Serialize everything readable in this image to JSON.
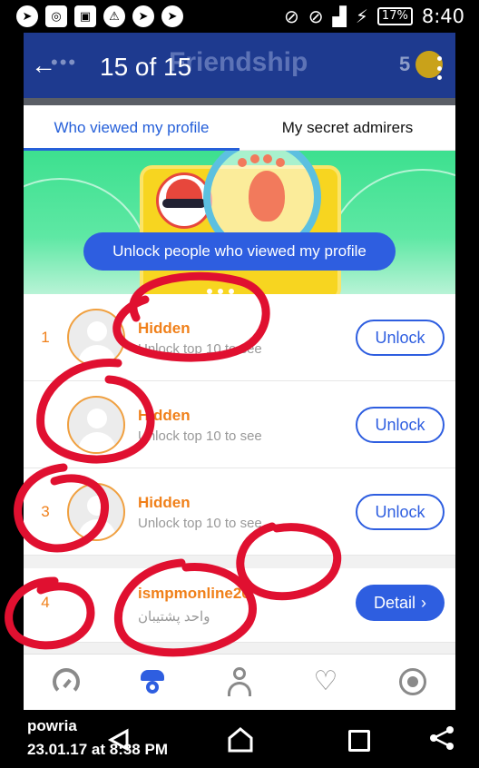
{
  "status_bar": {
    "battery": "17%",
    "time": "8:40"
  },
  "header": {
    "counter": "15 of 15",
    "title": "Friendship",
    "coins": "5"
  },
  "tabs": [
    {
      "label": "Who viewed my profile",
      "active": true
    },
    {
      "label": "My secret admirers",
      "active": false
    }
  ],
  "banner": {
    "button_label": "Unlock people who viewed my profile"
  },
  "viewers": [
    {
      "rank": "1",
      "name": "Hidden",
      "subtitle": "Unlock top 10 to see",
      "action": "Unlock"
    },
    {
      "rank": "",
      "name": "Hidden",
      "subtitle": "Unlock top 10 to see",
      "action": "Unlock"
    },
    {
      "rank": "3",
      "name": "Hidden",
      "subtitle": "Unlock top 10 to see",
      "action": "Unlock"
    },
    {
      "rank": "4",
      "name": "ismpmonline20",
      "subtitle": "واحد پشتیبان",
      "action": "Detail"
    }
  ],
  "bottom_nav": [
    "gauge-icon",
    "spy-icon",
    "profile-icon",
    "heart-plus-icon",
    "record-icon"
  ],
  "caption": {
    "name": "powria",
    "date": "23.01.17 at 8:38 PM"
  },
  "colors": {
    "header_bg": "#1e3a8f",
    "accent": "#2e5ee0",
    "orange": "#f0801a",
    "banner_green": "#3de08f",
    "scribble_red": "#e01030"
  }
}
